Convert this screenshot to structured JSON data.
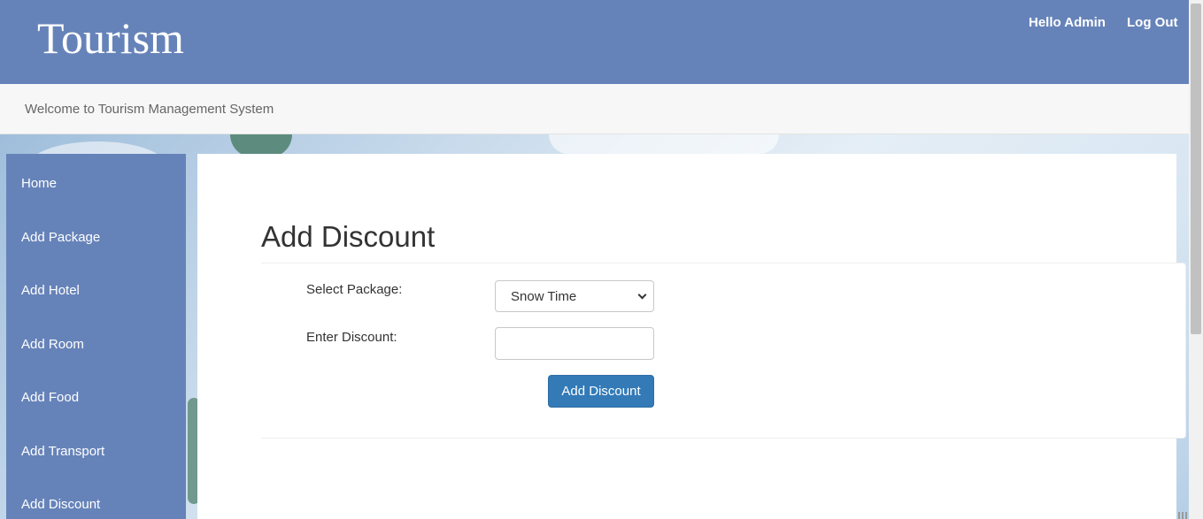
{
  "header": {
    "brand": "Tourism",
    "greeting": "Hello Admin",
    "logout_label": "Log Out"
  },
  "welcome": {
    "text": "Welcome to Tourism Management System"
  },
  "sidebar": {
    "items": [
      {
        "label": "Home"
      },
      {
        "label": "Add Package"
      },
      {
        "label": "Add Hotel"
      },
      {
        "label": "Add Room"
      },
      {
        "label": "Add Food"
      },
      {
        "label": "Add Transport"
      },
      {
        "label": "Add Discount"
      }
    ]
  },
  "main": {
    "title": "Add Discount",
    "form": {
      "package_label": "Select Package:",
      "package_selected": "Snow Time",
      "discount_label": "Enter Discount:",
      "discount_value": "",
      "submit_label": "Add Discount"
    }
  },
  "colors": {
    "header_bg": "#6683b9",
    "sidebar_bg": "#6683b9",
    "button_bg": "#337ab7"
  }
}
